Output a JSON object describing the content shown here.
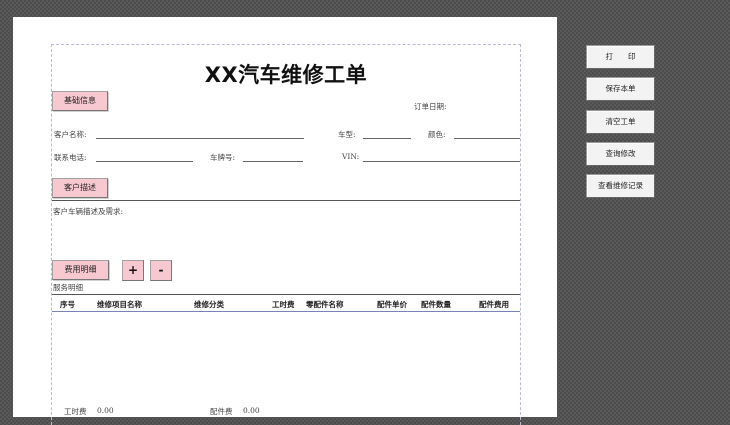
{
  "form": {
    "title": "XX汽车维修工单",
    "section_basic": "基础信息",
    "order_date_label": "订单日期:",
    "customer_name_label": "客户名称:",
    "car_model_label": "车型:",
    "color_label": "颜色:",
    "phone_label": "联系电话:",
    "plate_label": "车牌号:",
    "vin_label": "VIN:",
    "section_customer": "客户描述",
    "desc_label": "客户车辆描述及需求:",
    "section_fees": "费用明细",
    "add_label": "+",
    "remove_label": "-",
    "service_detail_label": "服务明细",
    "table_headers": [
      "序号",
      "维修项目名称",
      "维修分类",
      "工时费",
      "零配件名称",
      "配件单价",
      "配件数量",
      "配件费用"
    ],
    "summary_labor_label": "工时费",
    "summary_labor_value": "0.00",
    "summary_parts_label": "配件费",
    "summary_parts_value": "0.00"
  },
  "side_buttons": {
    "print": "打　　印",
    "save": "保存本单",
    "clear": "清空工单",
    "query": "查询修改",
    "view": "查看维修记录"
  }
}
